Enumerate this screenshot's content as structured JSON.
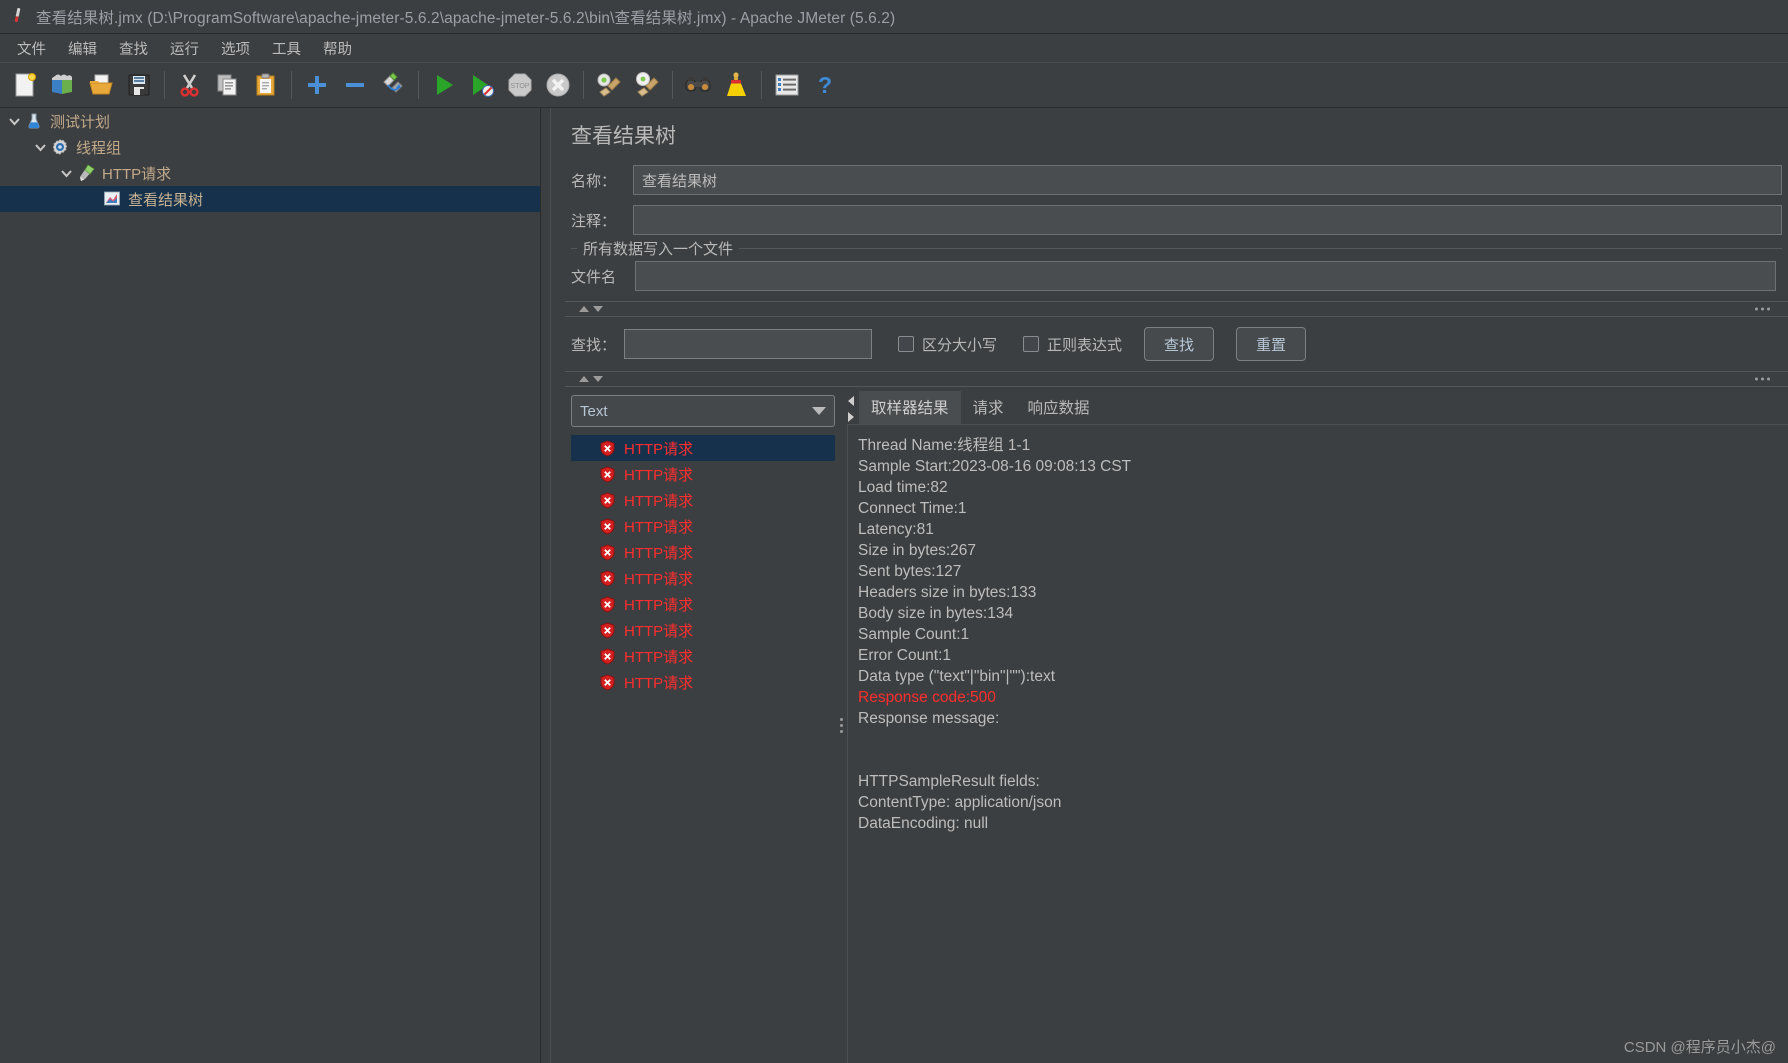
{
  "window": {
    "title": "查看结果树.jmx (D:\\ProgramSoftware\\apache-jmeter-5.6.2\\apache-jmeter-5.6.2\\bin\\查看结果树.jmx) - Apache JMeter (5.6.2)",
    "app_icon": "jmeter-feather-icon"
  },
  "menubar": {
    "items": [
      {
        "label": "文件"
      },
      {
        "label": "编辑"
      },
      {
        "label": "查找"
      },
      {
        "label": "运行"
      },
      {
        "label": "选项"
      },
      {
        "label": "工具"
      },
      {
        "label": "帮助"
      }
    ]
  },
  "toolbar": {
    "buttons": [
      {
        "name": "new-icon"
      },
      {
        "name": "templates-icon"
      },
      {
        "name": "open-icon"
      },
      {
        "name": "save-icon"
      },
      {
        "name": "cut-icon"
      },
      {
        "name": "copy-icon"
      },
      {
        "name": "paste-icon"
      },
      {
        "name": "expand-all-icon"
      },
      {
        "name": "collapse-all-icon"
      },
      {
        "name": "toggle-icon"
      },
      {
        "name": "start-icon"
      },
      {
        "name": "start-no-timers-icon"
      },
      {
        "name": "stop-icon"
      },
      {
        "name": "shutdown-icon"
      },
      {
        "name": "clear-icon"
      },
      {
        "name": "clear-all-icon"
      },
      {
        "name": "search-icon"
      },
      {
        "name": "search-reset-icon"
      },
      {
        "name": "function-helper-icon"
      },
      {
        "name": "help-icon"
      }
    ]
  },
  "tree": {
    "nodes": [
      {
        "label": "测试计划",
        "icon": "test-plan-icon",
        "depth": 0,
        "expanded": true,
        "selected": false
      },
      {
        "label": "线程组",
        "icon": "thread-group-icon",
        "depth": 1,
        "expanded": true,
        "selected": false
      },
      {
        "label": "HTTP请求",
        "icon": "http-request-icon",
        "depth": 2,
        "expanded": true,
        "selected": false
      },
      {
        "label": "查看结果树",
        "icon": "view-results-tree-icon",
        "depth": 3,
        "expanded": false,
        "selected": true
      }
    ]
  },
  "panel": {
    "title": "查看结果树",
    "name_label": "名称：",
    "name_value": "查看结果树",
    "comment_label": "注释：",
    "comment_value": "",
    "group_title": "所有数据写入一个文件",
    "filename_label": "文件名",
    "filename_value": ""
  },
  "search": {
    "label": "查找：",
    "value": "",
    "case_sensitive_label": "区分大小写",
    "case_sensitive_checked": false,
    "regex_label": "正则表达式",
    "regex_checked": false,
    "find_button": "查找",
    "reset_button": "重置"
  },
  "results": {
    "renderer_selected": "Text",
    "items": [
      {
        "label": "HTTP请求",
        "status": "error",
        "selected": true
      },
      {
        "label": "HTTP请求",
        "status": "error",
        "selected": false
      },
      {
        "label": "HTTP请求",
        "status": "error",
        "selected": false
      },
      {
        "label": "HTTP请求",
        "status": "error",
        "selected": false
      },
      {
        "label": "HTTP请求",
        "status": "error",
        "selected": false
      },
      {
        "label": "HTTP请求",
        "status": "error",
        "selected": false
      },
      {
        "label": "HTTP请求",
        "status": "error",
        "selected": false
      },
      {
        "label": "HTTP请求",
        "status": "error",
        "selected": false
      },
      {
        "label": "HTTP请求",
        "status": "error",
        "selected": false
      },
      {
        "label": "HTTP请求",
        "status": "error",
        "selected": false
      }
    ]
  },
  "detail": {
    "tabs": [
      {
        "label": "取样器结果",
        "active": true
      },
      {
        "label": "请求",
        "active": false
      },
      {
        "label": "响应数据",
        "active": false
      }
    ],
    "lines": [
      {
        "text": "Thread Name:线程组 1-1",
        "error": false
      },
      {
        "text": "Sample Start:2023-08-16 09:08:13 CST",
        "error": false
      },
      {
        "text": "Load time:82",
        "error": false
      },
      {
        "text": "Connect Time:1",
        "error": false
      },
      {
        "text": "Latency:81",
        "error": false
      },
      {
        "text": "Size in bytes:267",
        "error": false
      },
      {
        "text": "Sent bytes:127",
        "error": false
      },
      {
        "text": "Headers size in bytes:133",
        "error": false
      },
      {
        "text": "Body size in bytes:134",
        "error": false
      },
      {
        "text": "Sample Count:1",
        "error": false
      },
      {
        "text": "Error Count:1",
        "error": false
      },
      {
        "text": "Data type (\"text\"|\"bin\"|\"\"):text",
        "error": false
      },
      {
        "text": "Response code:500",
        "error": true
      },
      {
        "text": "Response message:",
        "error": false
      },
      {
        "text": "",
        "error": false
      },
      {
        "text": "",
        "error": false
      },
      {
        "text": "HTTPSampleResult fields:",
        "error": false
      },
      {
        "text": "ContentType: application/json",
        "error": false
      },
      {
        "text": "DataEncoding: null",
        "error": false
      }
    ]
  },
  "watermark": "CSDN @程序员小杰@",
  "colors": {
    "background": "#3c3f41",
    "selection": "#15314c",
    "tree_text": "#c2a98a",
    "error_red": "#ff2d2d",
    "button_text": "#b6c6d6"
  }
}
